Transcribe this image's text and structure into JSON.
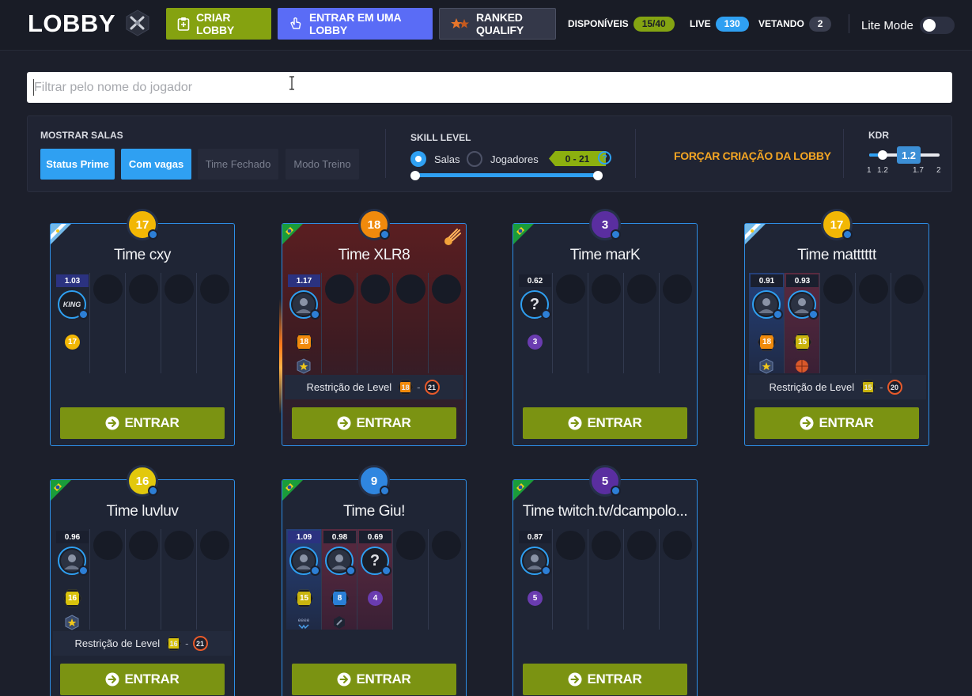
{
  "header": {
    "logo": "LOBBY",
    "criar_lobby": "CRIAR LOBBY",
    "entrar_lobby": "ENTRAR EM UMA LOBBY",
    "ranked": "RANKED QUALIFY",
    "stats": [
      {
        "label": "DISPONÍVEIS",
        "value": "15/40",
        "color": "#84a412"
      },
      {
        "label": "LIVE",
        "value": "130",
        "color": "#2fa0f2"
      },
      {
        "label": "VETANDO",
        "value": "2",
        "color": "#3a3e4f"
      }
    ],
    "lite_mode": "Lite Mode"
  },
  "search": {
    "placeholder": "Filtrar pelo nome do jogador",
    "value": ""
  },
  "filters": {
    "mostrar_salas_label": "MOSTRAR SALAS",
    "buttons": [
      {
        "label": "Status Prime",
        "active": true
      },
      {
        "label": "Com vagas",
        "active": true
      },
      {
        "label": "Time Fechado",
        "active": false
      },
      {
        "label": "Modo Treino",
        "active": false
      }
    ],
    "skill_level_label": "SKILL LEVEL",
    "radio_salas": "Salas",
    "radio_jogadores": "Jogadores",
    "selected_radio": "Salas",
    "range": "0 - 21",
    "help": "?",
    "forcar": "FORÇAR CRIAÇÃO DA LOBBY",
    "kdr_label": "KDR",
    "kdr_value": "1.2",
    "kdr_ticks": [
      "1",
      "1.2",
      "1.7",
      "2"
    ]
  },
  "lobbies": [
    {
      "title": "Time cxy",
      "level": "17",
      "flag": "argentina",
      "fire": false,
      "players": [
        {
          "kdr": "1.03",
          "avatar": "KING",
          "level": "17",
          "lvl_shape": "round",
          "lvl_color": "#f2b705"
        }
      ],
      "restriction": null,
      "enter": "ENTRAR"
    },
    {
      "title": "Time XLR8",
      "level": "18",
      "flag": "brazil",
      "fire": true,
      "players": [
        {
          "kdr": "1.17",
          "avatar": "",
          "level": "18",
          "lvl_shape": "hex",
          "lvl_color": "#f08a0c",
          "medal": "star"
        }
      ],
      "restriction": {
        "label": "Restrição de Level",
        "min": "18",
        "max": "21"
      },
      "enter": "ENTRAR"
    },
    {
      "title": "Time marK",
      "level": "3",
      "flag": "brazil",
      "fire": false,
      "players": [
        {
          "kdr": "0.62",
          "avatar": "?",
          "level": "3",
          "lvl_shape": "round",
          "lvl_color": "#6a3cb0"
        }
      ],
      "restriction": null,
      "enter": "ENTRAR"
    },
    {
      "title": "Time matttttt",
      "level": "17",
      "flag": "argentina",
      "fire": false,
      "players": [
        {
          "kdr": "0.91",
          "avatar": "",
          "level": "18",
          "lvl_shape": "hex",
          "lvl_color": "#f08a0c",
          "medal": "star"
        },
        {
          "kdr": "0.93",
          "avatar": "",
          "level": "15",
          "lvl_shape": "hex",
          "lvl_color": "#c9b40e",
          "medal": "ball"
        }
      ],
      "restriction": {
        "label": "Restrição de Level",
        "min": "15",
        "max": "20"
      },
      "enter": "ENTRAR"
    },
    {
      "title": "Time luvluv",
      "level": "16",
      "flag": "brazil",
      "fire": false,
      "players": [
        {
          "kdr": "0.96",
          "avatar": "",
          "level": "16",
          "lvl_shape": "hex",
          "lvl_color": "#d8c20c",
          "medal": "star"
        }
      ],
      "restriction": {
        "label": "Restrição de Level",
        "min": "16",
        "max": "21"
      },
      "enter": "ENTRAR"
    },
    {
      "title": "Time Giu!",
      "level": "9",
      "flag": "brazil",
      "fire": false,
      "players": [
        {
          "kdr": "1.09",
          "avatar": "",
          "level": "15",
          "lvl_shape": "hex",
          "lvl_color": "#c9b40e",
          "medal": "team"
        },
        {
          "kdr": "0.98",
          "avatar": "",
          "level": "8",
          "lvl_shape": "hex",
          "lvl_color": "#2a7fd6",
          "medal": "shield"
        },
        {
          "kdr": "0.69",
          "avatar": "?",
          "level": "4",
          "lvl_shape": "round",
          "lvl_color": "#6a3cb0"
        }
      ],
      "restriction": null,
      "enter": "ENTRAR"
    },
    {
      "title": "Time twitch.tv/dcampolo...",
      "level": "5",
      "flag": "brazil",
      "fire": false,
      "players": [
        {
          "kdr": "0.87",
          "avatar": "",
          "level": "5",
          "lvl_shape": "round",
          "lvl_color": "#6a3cb0"
        }
      ],
      "restriction": null,
      "enter": "ENTRAR"
    }
  ]
}
